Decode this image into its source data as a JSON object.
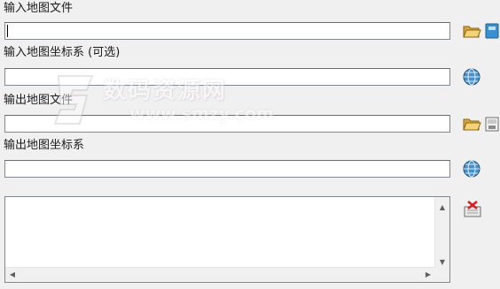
{
  "labels": {
    "input_map_file": "输入地图文件",
    "input_map_crs": "输入地图坐标系 (可选)",
    "output_map_file": "输出地图文件",
    "output_map_crs": "输出地图坐标系"
  },
  "fields": {
    "input_map_file": "",
    "input_map_crs": "",
    "output_map_file": "",
    "output_map_crs": ""
  },
  "watermark": {
    "title": "数码资源网",
    "url": "www.smzy.com"
  },
  "icons": {
    "open_folder": "open-folder-icon",
    "help_book": "help-book-icon",
    "globe": "globe-icon",
    "save_dialog": "save-file-icon",
    "clear_log": "clear-log-icon"
  }
}
